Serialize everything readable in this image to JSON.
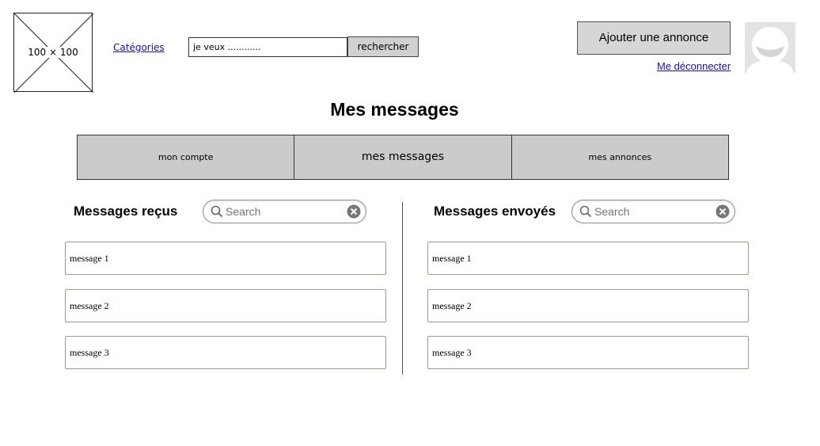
{
  "header": {
    "logo_label": "100 × 100",
    "categories_label": "Catégories",
    "search_value": "je veux ............",
    "search_button": "rechercher",
    "add_ad_button": "Ajouter une annonce",
    "logout_label": "Me déconnecter",
    "avatar_icon": "user-avatar-icon"
  },
  "page_title": "Mes messages",
  "tabs": [
    {
      "label": "mon compte",
      "active": false
    },
    {
      "label": "mes messages",
      "active": true
    },
    {
      "label": "mes annonces",
      "active": false
    }
  ],
  "received": {
    "title": "Messages reçus",
    "search_placeholder": "Search",
    "messages": [
      "message 1",
      "message 2",
      "message 3"
    ]
  },
  "sent": {
    "title": "Messages envoyés",
    "search_placeholder": "Search",
    "messages": [
      "message 1",
      "message 2",
      "message 3"
    ]
  }
}
